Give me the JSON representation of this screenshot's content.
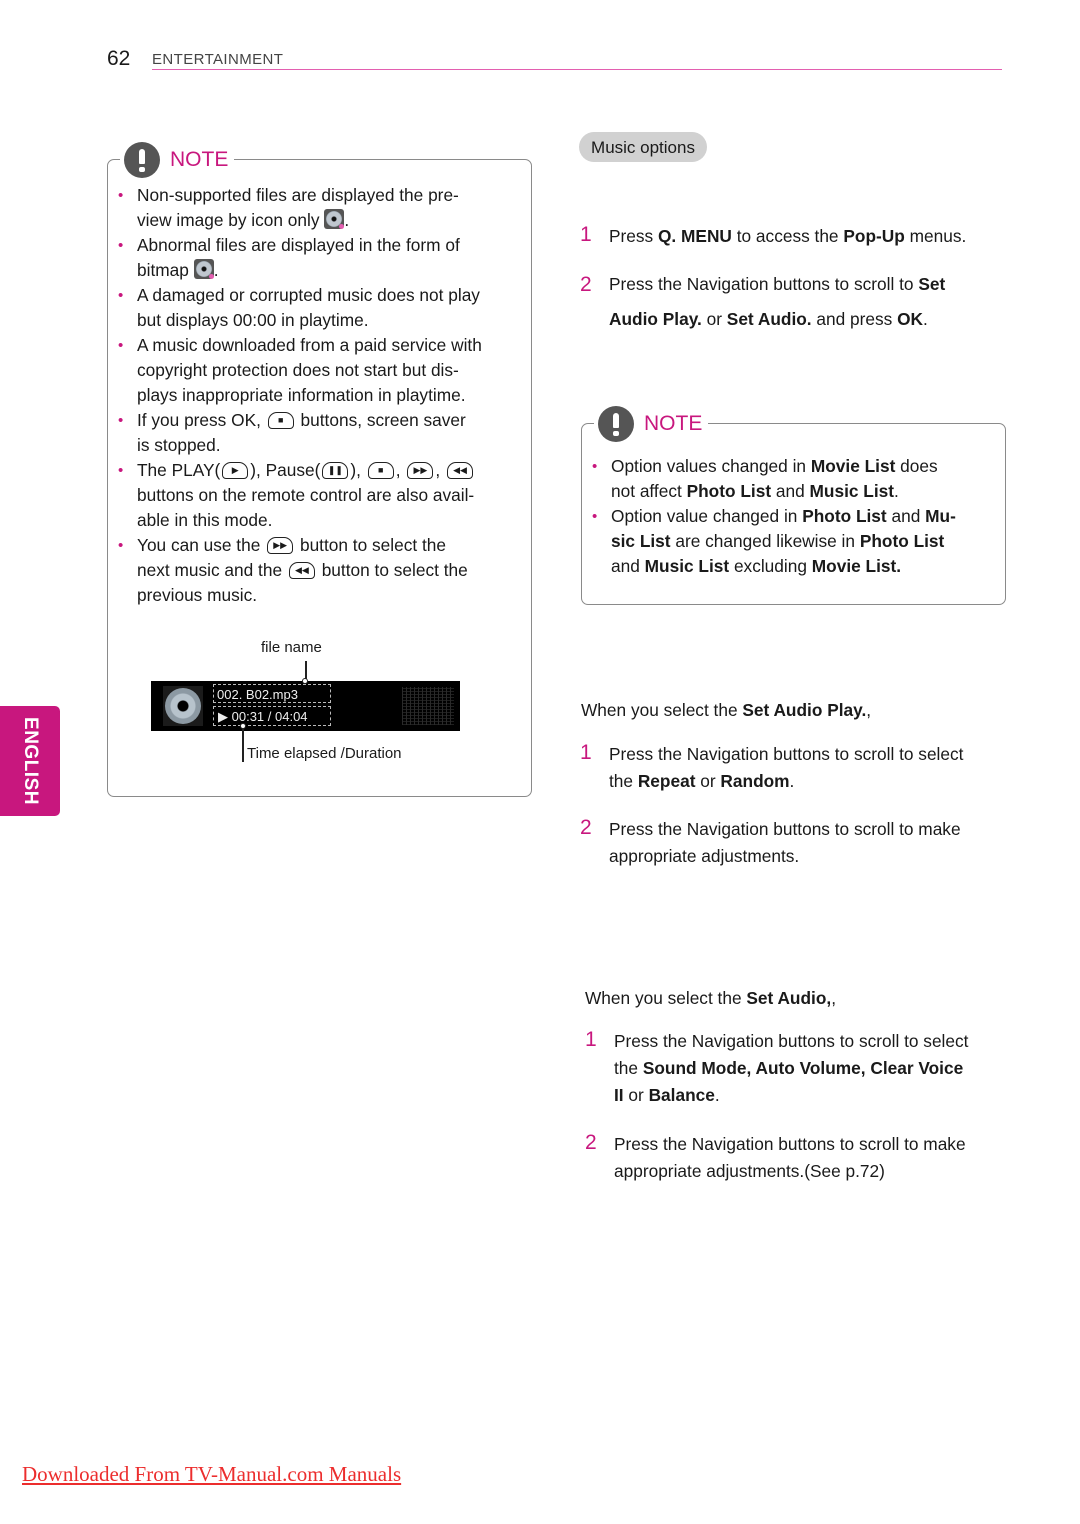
{
  "header": {
    "page_number": "62",
    "section": "ENTERTAINMENT"
  },
  "side_tab": {
    "label": "ENGLISH"
  },
  "left_note": {
    "title": "NOTE",
    "icon": "exclamation-icon",
    "bullets": [
      {
        "line1": "Non-supported files are displayed the pre-",
        "line2": "view image by icon only",
        "line2_tail": "."
      },
      {
        "line1": "Abnormal files are displayed in the form of",
        "line2": "bitmap",
        "line2_tail": "."
      },
      {
        "line1": "A damaged or corrupted music does not play",
        "line2": "but displays 00:00 in playtime."
      },
      {
        "line1": "A music downloaded from a paid service with",
        "line2": "copyright protection does not start but dis-",
        "line3": "plays inappropriate information in playtime."
      },
      {
        "line1a": "If you press OK,",
        "line1b": "buttons, screen saver",
        "line2": "is stopped."
      },
      {
        "line1a": "The PLAY(",
        "line1b": "), Pause(",
        "line1c": "),",
        "line1d": ",",
        "line1e": ",",
        "line2": "buttons on the remote control are also avail-",
        "line3": "able in this mode."
      },
      {
        "line1a": "You can use the",
        "line1b": "button to select the",
        "line2a": "next music and the",
        "line2b": "button to select the",
        "line3": "previous music."
      }
    ],
    "player": {
      "file_name_label": "file name",
      "file_name": "002. B02.mp3",
      "play_icon": "▶",
      "time": "00:31 / 04:04",
      "time_label": "Time elapsed /Duration"
    }
  },
  "right": {
    "pill": "Music options",
    "steps_a": [
      {
        "num": "1",
        "pre": "Press ",
        "b1": "Q. MENU",
        "mid": " to access the ",
        "b2": "Pop-Up",
        "post": " menus."
      },
      {
        "num": "2",
        "line1": "Press the Navigation buttons to scroll to ",
        "b1": "Set",
        "b2": "Audio Play.",
        "mid": " or ",
        "b3": "Set Audio.",
        "mid2": " and press ",
        "b4": "OK",
        "post": "."
      }
    ],
    "note": {
      "title": "NOTE",
      "bullets": [
        {
          "a": "Option values changed in ",
          "b": "Movie List",
          "c": " does",
          "d": "not affect ",
          "e": "Photo List",
          "f": " and ",
          "g": "Music List",
          "h": "."
        },
        {
          "a": "Option value changed in ",
          "b": "Photo List",
          "c": " and ",
          "d": "Mu-",
          "e": "sic List",
          "f": " are changed likewise in ",
          "g": "Photo List",
          "h": "and ",
          "i": "Music List",
          "j": " excluding ",
          "k": "Movie List."
        }
      ]
    },
    "set_audio_play": {
      "intro_pre": "When you select the ",
      "intro_bold": "Set Audio Play.",
      "intro_post": ",",
      "steps": [
        {
          "num": "1",
          "line1": "Press the Navigation buttons to scroll to select",
          "pre": "the ",
          "b1": "Repeat",
          "mid": " or ",
          "b2": "Random",
          "post": "."
        },
        {
          "num": "2",
          "line1": "Press the Navigation buttons to scroll to make",
          "line2": "appropriate adjustments."
        }
      ]
    },
    "set_audio": {
      "intro_pre": "When you select the ",
      "intro_bold": "Set Audio,",
      "intro_post": ",",
      "steps": [
        {
          "num": "1",
          "line1": "Press the Navigation buttons to scroll to select",
          "pre": "the ",
          "b1": "Sound Mode, Auto Volume, Clear Voice",
          "b2": "II",
          "mid": " or ",
          "b3": "Balance",
          "post": "."
        },
        {
          "num": "2",
          "line1": "Press the Navigation buttons to scroll to make",
          "line2": "appropriate adjustments.(See p.72)"
        }
      ]
    }
  },
  "footer": {
    "link_text": "Downloaded From TV-Manual.com Manuals"
  },
  "colors": {
    "accent": "#c8177e",
    "header_rule": "#e35fb0",
    "link": "#ec2d2d",
    "pill": "#d1d1d1"
  }
}
